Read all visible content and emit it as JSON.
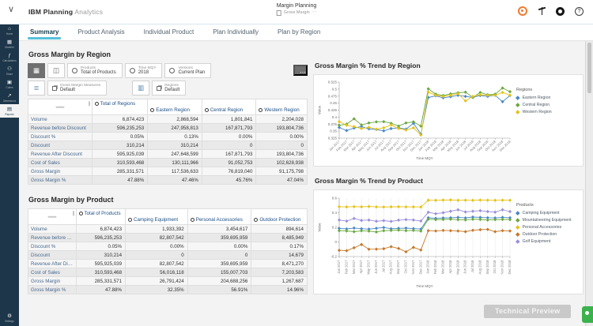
{
  "header": {
    "brand": {
      "ibm": "IBM",
      "planning": "Planning",
      "analytics": "Analytics"
    },
    "book": {
      "title": "Margin Planning",
      "subtitle": "Gross Margin",
      "overflow": "⋯"
    },
    "icons": {
      "chevron": "∨",
      "help": "?"
    }
  },
  "tabs": [
    {
      "label": "Summary",
      "active": true
    },
    {
      "label": "Product Analysis",
      "active": false
    },
    {
      "label": "Individual Product",
      "active": false
    },
    {
      "label": "Plan Individually",
      "active": false
    },
    {
      "label": "Plan by Region",
      "active": false
    }
  ],
  "sidebar": {
    "items": [
      {
        "label": "Home",
        "glyph": "⌂",
        "selected": false
      },
      {
        "label": "Modeler",
        "glyph": "▦",
        "selected": false
      },
      {
        "label": "Calculations",
        "glyph": "ƒ",
        "selected": false
      },
      {
        "label": "Share",
        "glyph": "⚇",
        "selected": false
      },
      {
        "label": "Cubes",
        "glyph": "▣",
        "selected": false
      },
      {
        "label": "Dimensions",
        "glyph": "↗",
        "selected": false
      },
      {
        "label": "Reports",
        "glyph": "▤",
        "selected": true
      }
    ],
    "bottom": {
      "label": "Settings",
      "glyph": "⚙"
    }
  },
  "region_section": {
    "title": "Gross Margin by Region",
    "toolbar": {
      "grid_glyph": "▦",
      "bench_glyph": "◫",
      "more_glyph": "⋯",
      "rows_glyph": "≣",
      "columns_glyph": "▥",
      "context_chips": [
        {
          "dimension": "Products",
          "member": "Total of Products"
        },
        {
          "dimension": "Time MQY",
          "member": "2018"
        },
        {
          "dimension": "Versions",
          "member": "Current Plan"
        }
      ],
      "axis_chips": [
        {
          "dimension": "Gross Margin Measures",
          "member": "Default"
        },
        {
          "dimension": "Regions",
          "member": "Default"
        }
      ]
    },
    "table": {
      "columns": [
        "Total of Regions",
        "Eastern Region",
        "Central Region",
        "Western Region"
      ],
      "rows": [
        {
          "label": "Volume",
          "values": [
            "6,874,423",
            "2,868,594",
            "1,801,841",
            "2,204,028"
          ]
        },
        {
          "label": "Revenue before Discount",
          "values": [
            "596,235,253",
            "247,958,813",
            "167,871,793",
            "193,804,736"
          ]
        },
        {
          "label": "Discount %",
          "values": [
            "0.05%",
            "0.13%",
            "0.00%",
            "0.00%"
          ]
        },
        {
          "label": "Discount",
          "values": [
            "310,214",
            "310,214",
            "0",
            "0"
          ]
        },
        {
          "label": "Revenue After Discount",
          "values": [
            "595,925,039",
            "247,648,599",
            "167,871,793",
            "193,804,736"
          ]
        },
        {
          "label": "Cost of Sales",
          "values": [
            "310,593,468",
            "130,111,966",
            "91,052,753",
            "102,628,938"
          ]
        },
        {
          "label": "Gross Margin",
          "values": [
            "285,331,571",
            "117,536,633",
            "76,819,040",
            "91,175,798"
          ]
        },
        {
          "label": "Gross Margin %",
          "values": [
            "47.88%",
            "47.46%",
            "45.76%",
            "47.04%"
          ]
        }
      ]
    }
  },
  "product_section": {
    "title": "Gross Margin by Product",
    "table": {
      "columns": [
        "Total of Products",
        "Camping Equipment",
        "Personal Accessories",
        "Outdoor Protection"
      ],
      "rows": [
        {
          "label": "Volume",
          "values": [
            "6,874,423",
            "1,933,392",
            "3,454,617",
            "894,614"
          ]
        },
        {
          "label": "Revenue before Discount",
          "values": [
            "596,235,253",
            "82,807,542",
            "359,695,959",
            "8,485,949"
          ]
        },
        {
          "label": "Discount %",
          "values": [
            "0.05%",
            "0.00%",
            "0.00%",
            "0.17%"
          ]
        },
        {
          "label": "Discount",
          "values": [
            "310,214",
            "0",
            "0",
            "14,679"
          ]
        },
        {
          "label": "Revenue After Discount",
          "values": [
            "595,925,039",
            "82,807,542",
            "359,695,959",
            "8,471,270"
          ]
        },
        {
          "label": "Cost of Sales",
          "values": [
            "310,593,468",
            "56,016,118",
            "155,007,703",
            "7,203,583"
          ]
        },
        {
          "label": "Gross Margin",
          "values": [
            "285,331,571",
            "26,791,424",
            "204,688,256",
            "1,267,687"
          ]
        },
        {
          "label": "Gross Margin %",
          "values": [
            "47.88%",
            "32.35%",
            "56.91%",
            "14.96%"
          ]
        }
      ]
    }
  },
  "chart_data": [
    {
      "type": "line",
      "title": "Gross Margin % Trend by Region",
      "legend_title": "Regions",
      "xlabel": "Time MQY",
      "ylabel": "Value",
      "ylim": [
        0.325,
        0.525
      ],
      "yticks": [
        "0.325",
        "0.35",
        "0.375",
        "0.4",
        "0.425",
        "0.45",
        "0.475",
        "0.5",
        "0.525"
      ],
      "xtick_rotation": -45,
      "grid_vertical": false,
      "x": [
        "Jan 2017",
        "Feb 2017",
        "Mar 2017",
        "Apr 2017",
        "May 2017",
        "Jun 2017",
        "Jul 2017",
        "Aug 2017",
        "Sep 2017",
        "Oct 2017",
        "Nov 2017",
        "Dec 2017",
        "Jan 2018",
        "Feb 2018",
        "Mar 2018",
        "Apr 2018",
        "May 2018",
        "Jun 2018",
        "Jul 2018",
        "Aug 2018",
        "Sep 2018",
        "Oct 2018",
        "Nov 2018",
        "Dec 2018"
      ],
      "series": [
        {
          "name": "Eastern Region",
          "color": "#4a87c5",
          "values": [
            0.363,
            0.352,
            0.361,
            0.366,
            0.358,
            0.356,
            0.351,
            0.359,
            0.362,
            0.357,
            0.378,
            0.34,
            0.47,
            0.476,
            0.469,
            0.473,
            0.478,
            0.474,
            0.47,
            0.477,
            0.474,
            0.478,
            0.455,
            0.477
          ]
        },
        {
          "name": "Central Region",
          "color": "#69a83f",
          "values": [
            0.371,
            0.375,
            0.394,
            0.372,
            0.379,
            0.383,
            0.384,
            0.378,
            0.368,
            0.379,
            0.383,
            0.368,
            0.501,
            0.482,
            0.477,
            0.483,
            0.487,
            0.489,
            0.471,
            0.488,
            0.48,
            0.482,
            0.504,
            0.491
          ]
        },
        {
          "name": "Western Region",
          "color": "#e4c318",
          "values": [
            0.384,
            0.371,
            0.366,
            0.359,
            0.364,
            0.357,
            0.362,
            0.372,
            0.359,
            0.354,
            0.362,
            0.336,
            0.489,
            0.478,
            0.474,
            0.478,
            0.484,
            0.458,
            0.474,
            0.48,
            0.478,
            0.478,
            0.488,
            0.478
          ]
        }
      ]
    },
    {
      "type": "line",
      "title": "Gross Margin % Trend by Product",
      "legend_title": "Products",
      "xlabel": "Time MQY",
      "ylabel": "Value",
      "ylim": [
        -0.2,
        0.6
      ],
      "yticks": [
        "-0.2",
        "0",
        "0.2",
        "0.4",
        "0.6"
      ],
      "xtick_rotation": -90,
      "grid_vertical": true,
      "x": [
        "Jan 2017",
        "Feb 2017",
        "Mar 2017",
        "Apr 2017",
        "May 2017",
        "Jun 2017",
        "Jul 2017",
        "Aug 2017",
        "Sep 2017",
        "Oct 2017",
        "Nov 2017",
        "Dec 2017",
        "Jan 2018",
        "Feb 2018",
        "Mar 2018",
        "Apr 2018",
        "May 2018",
        "Jun 2018",
        "Jul 2018",
        "Aug 2018",
        "Sep 2018",
        "Oct 2018",
        "Nov 2018",
        "Dec 2018"
      ],
      "series": [
        {
          "name": "Camping Equipment",
          "color": "#4a87c5",
          "values": [
            0.185,
            0.178,
            0.19,
            0.182,
            0.175,
            0.187,
            0.198,
            0.18,
            0.186,
            0.189,
            0.183,
            0.176,
            0.331,
            0.323,
            0.329,
            0.331,
            0.336,
            0.329,
            0.341,
            0.336,
            0.331,
            0.329,
            0.336,
            0.331
          ]
        },
        {
          "name": "Mountaineering Equipment",
          "color": "#69a83f",
          "values": [
            0.155,
            0.15,
            0.141,
            0.152,
            0.148,
            0.136,
            0.153,
            0.158,
            0.162,
            0.155,
            0.158,
            0.148,
            0.311,
            0.305,
            0.308,
            0.311,
            0.305,
            0.302,
            0.311,
            0.308,
            0.301,
            0.305,
            0.308,
            0.306
          ]
        },
        {
          "name": "Personal Accessories",
          "color": "#e4c318",
          "values": [
            0.482,
            0.48,
            0.483,
            0.481,
            0.485,
            0.48,
            0.478,
            0.481,
            0.482,
            0.48,
            0.48,
            0.479,
            0.572,
            0.57,
            0.573,
            0.575,
            0.571,
            0.572,
            0.57,
            0.573,
            0.572,
            0.57,
            0.572,
            0.571
          ]
        },
        {
          "name": "Outdoor Protection",
          "color": "#c5782a",
          "values": [
            -0.115,
            -0.12,
            -0.08,
            -0.035,
            -0.1,
            -0.098,
            -0.093,
            -0.065,
            -0.09,
            -0.135,
            -0.075,
            -0.11,
            0.155,
            0.15,
            0.158,
            0.155,
            0.15,
            0.14,
            0.16,
            0.168,
            0.172,
            0.14,
            0.155,
            0.15
          ]
        },
        {
          "name": "Golf Equipment",
          "color": "#9a8fdc",
          "values": [
            0.3,
            0.285,
            0.321,
            0.295,
            0.301,
            0.283,
            0.292,
            0.281,
            0.298,
            0.306,
            0.3,
            0.286,
            0.406,
            0.386,
            0.4,
            0.421,
            0.441,
            0.411,
            0.421,
            0.428,
            0.416,
            0.408,
            0.441,
            0.416
          ]
        }
      ]
    }
  ],
  "footer": {
    "technical_preview": "Technical Preview"
  }
}
